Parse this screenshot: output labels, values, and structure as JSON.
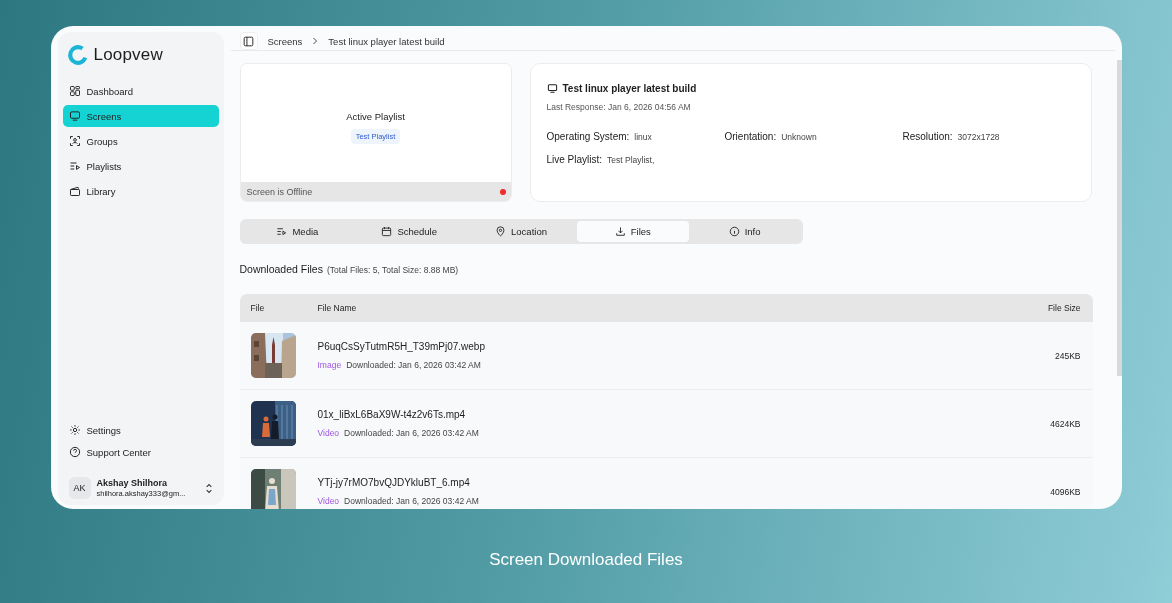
{
  "app": {
    "logo": "Loopvew"
  },
  "sidebar": {
    "items": [
      {
        "label": "Dashboard",
        "selected": false
      },
      {
        "label": "Screens",
        "selected": true
      },
      {
        "label": "Groups",
        "selected": false
      },
      {
        "label": "Playlists",
        "selected": false
      },
      {
        "label": "Library",
        "selected": false
      }
    ],
    "footer_items": [
      {
        "label": "Settings"
      },
      {
        "label": "Support Center"
      }
    ],
    "user": {
      "initials": "AK",
      "name": "Akshay Shilhora",
      "email": "shilhora.akshay333@gm..."
    }
  },
  "breadcrumb": [
    "Screens",
    "Test linux player latest build"
  ],
  "preview": {
    "title": "Active Playlist",
    "playlist": "Test Playlist",
    "status": "Screen is Offline",
    "online": false
  },
  "screen_info": {
    "name": "Test linux player latest build",
    "last_response": "Last Response: Jan 6, 2026 04:56 AM",
    "fields": [
      {
        "label": "Operating System:",
        "value": "linux"
      },
      {
        "label": "Orientation:",
        "value": "Unknown"
      },
      {
        "label": "Resolution:",
        "value": "3072x1728"
      },
      {
        "label": "Live Playlist:",
        "value": "Test Playlist,"
      }
    ]
  },
  "tabs": [
    {
      "label": "Media",
      "selected": false
    },
    {
      "label": "Schedule",
      "selected": false
    },
    {
      "label": "Location",
      "selected": false
    },
    {
      "label": "Files",
      "selected": true
    },
    {
      "label": "Info",
      "selected": false
    }
  ],
  "downloads": {
    "title": "Downloaded Files",
    "summary": "(Total Files: 5, Total Size: 8.88 MB)"
  },
  "table": {
    "columns": [
      "File",
      "File Name",
      "File Size"
    ],
    "rows": [
      {
        "name": "P6uqCsSyTutmR5H_T39mPj07.webp",
        "type": "Image",
        "downloaded": "Downloaded: Jan 6, 2026 03:42 AM",
        "size": "245KB"
      },
      {
        "name": "01x_liBxL6BaX9W-t4z2v6Ts.mp4",
        "type": "Video",
        "downloaded": "Downloaded: Jan 6, 2026 03:42 AM",
        "size": "4624KB"
      },
      {
        "name": "YTj-jy7rMO7bvQJDYkluBT_6.mp4",
        "type": "Video",
        "downloaded": "Downloaded: Jan 6, 2026 03:42 AM",
        "size": "4096KB"
      }
    ]
  },
  "caption": "Screen Downloaded Files"
}
